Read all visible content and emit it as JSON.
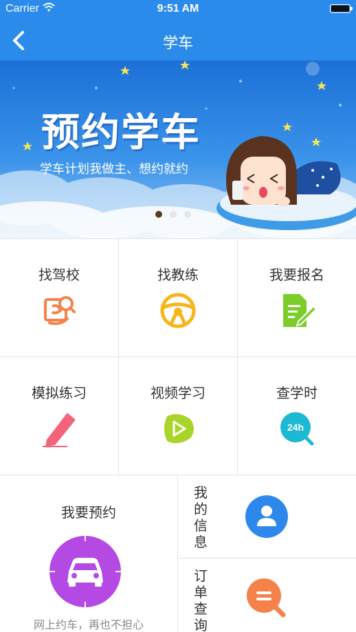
{
  "status_bar": {
    "carrier": "Carrier",
    "time": "9:51 AM"
  },
  "nav": {
    "title": "学车",
    "back_icon": "chevron-left-icon"
  },
  "banner": {
    "headline": "预约学车",
    "subtitle": "学车计划我做主、想约就约",
    "slide_count": 3,
    "active_slide": 1
  },
  "grid": [
    {
      "label": "找驾校",
      "icon": "find-school-icon",
      "color": "#f5824a"
    },
    {
      "label": "找教练",
      "icon": "steering-wheel-icon",
      "color": "#f7b519"
    },
    {
      "label": "我要报名",
      "icon": "signup-form-icon",
      "color": "#7ccd2a"
    },
    {
      "label": "模拟练习",
      "icon": "pencil-icon",
      "color": "#f2647a"
    },
    {
      "label": "视频学习",
      "icon": "video-play-icon",
      "color": "#a9d42a"
    },
    {
      "label": "查学时",
      "icon": "hours-24h-icon",
      "color": "#1cb9d2"
    }
  ],
  "hours_badge": "24h",
  "appointment": {
    "label": "我要预约",
    "description": "网上约车，再也不担心",
    "icon": "car-icon",
    "color": "#b549e4"
  },
  "my_info": {
    "label": "我的信息",
    "icon": "user-icon",
    "color": "#2e88ec"
  },
  "order_query": {
    "label": "订单查询",
    "icon": "order-search-icon",
    "color": "#f5824a"
  },
  "colors": {
    "nav_blue": "#2b8bea",
    "divider": "#e3e3e3"
  }
}
